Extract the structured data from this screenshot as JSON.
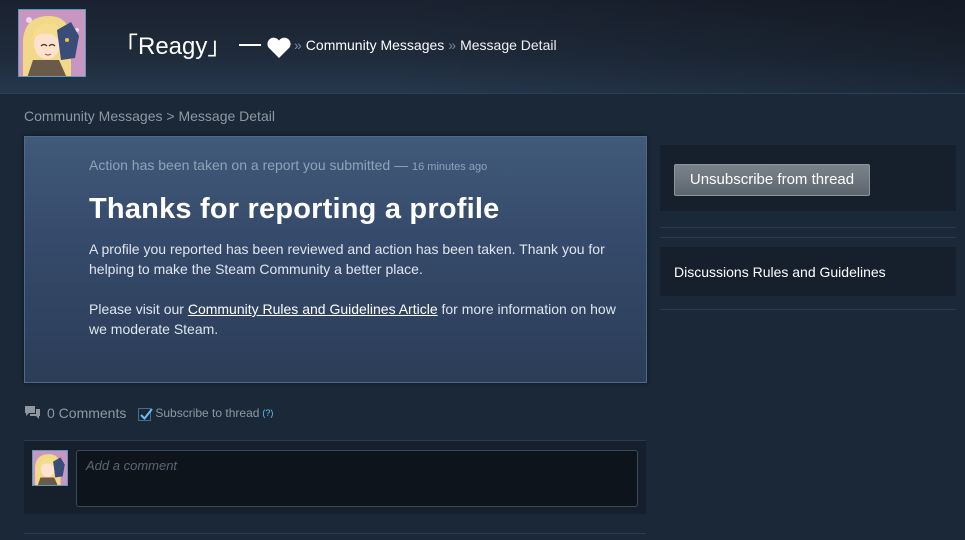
{
  "header": {
    "persona_name": "「Reagy」 一",
    "breadcrumb_sep": "»",
    "breadcrumb_1": "Community Messages",
    "breadcrumb_2": "Message Detail"
  },
  "breadcrumb": {
    "link": "Community Messages",
    "sep": ">",
    "current": "Message Detail"
  },
  "message": {
    "subtitle": "Action has been taken on a report you submitted",
    "dash": "—",
    "time": "16 minutes ago",
    "title": "Thanks for reporting a profile",
    "paragraph1": "A profile you reported has been reviewed and action has been taken. Thank you for helping to make the Steam Community a better place.",
    "paragraph2_pre": "Please visit our ",
    "paragraph2_link": "Community Rules and Guidelines Article",
    "paragraph2_post": " for more information on how we moderate Steam."
  },
  "comments": {
    "count_label": "0 Comments",
    "subscribe_label": "Subscribe to thread",
    "subscribe_checked": true,
    "help_label": "(?)",
    "input_placeholder": "Add a comment",
    "input_value": ""
  },
  "sidebar": {
    "unsubscribe_label": "Unsubscribe from thread",
    "rules_link": "Discussions Rules and Guidelines"
  },
  "colors": {
    "page_bg": "#1b2838",
    "card_top": "#415a79",
    "card_bottom": "#2b3d57",
    "link_accent": "#67c1f5"
  },
  "icons": {
    "heart": "heart-icon",
    "comments": "comments-icon",
    "checkbox": "checkmark-icon"
  }
}
